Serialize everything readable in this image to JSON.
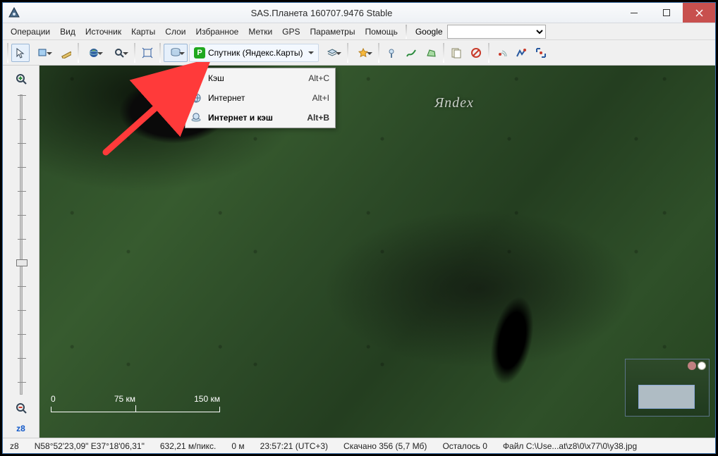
{
  "title": "SAS.Планета 160707.9476 Stable",
  "menu": [
    "Операции",
    "Вид",
    "Источник",
    "Карты",
    "Слои",
    "Избранное",
    "Метки",
    "GPS",
    "Параметры",
    "Помощь"
  ],
  "search_provider": "Google",
  "map_source_label": "Спутник (Яндекс.Карты)",
  "watermark": "Яndex",
  "dropdown": {
    "items": [
      {
        "label": "Кэш",
        "shortcut": "Alt+C",
        "selected": false
      },
      {
        "label": "Интернет",
        "shortcut": "Alt+I",
        "selected": false
      },
      {
        "label": "Интернет и кэш",
        "shortcut": "Alt+B",
        "selected": true
      }
    ]
  },
  "zoom_label": "z8",
  "scale": {
    "zero": "0",
    "mid": "75 км",
    "end": "150 км"
  },
  "status": {
    "zoom": "z8",
    "coords": "N58°52'23,09\" E37°18'06,31\"",
    "mpp": "632,21 м/пикс.",
    "elev": "0 м",
    "time": "23:57:21 (UTC+3)",
    "downloaded": "Скачано 356 (5,7 Мб)",
    "remaining": "Осталось 0",
    "file": "Файл C:\\Use...at\\z8\\0\\x77\\0\\y38.jpg"
  }
}
